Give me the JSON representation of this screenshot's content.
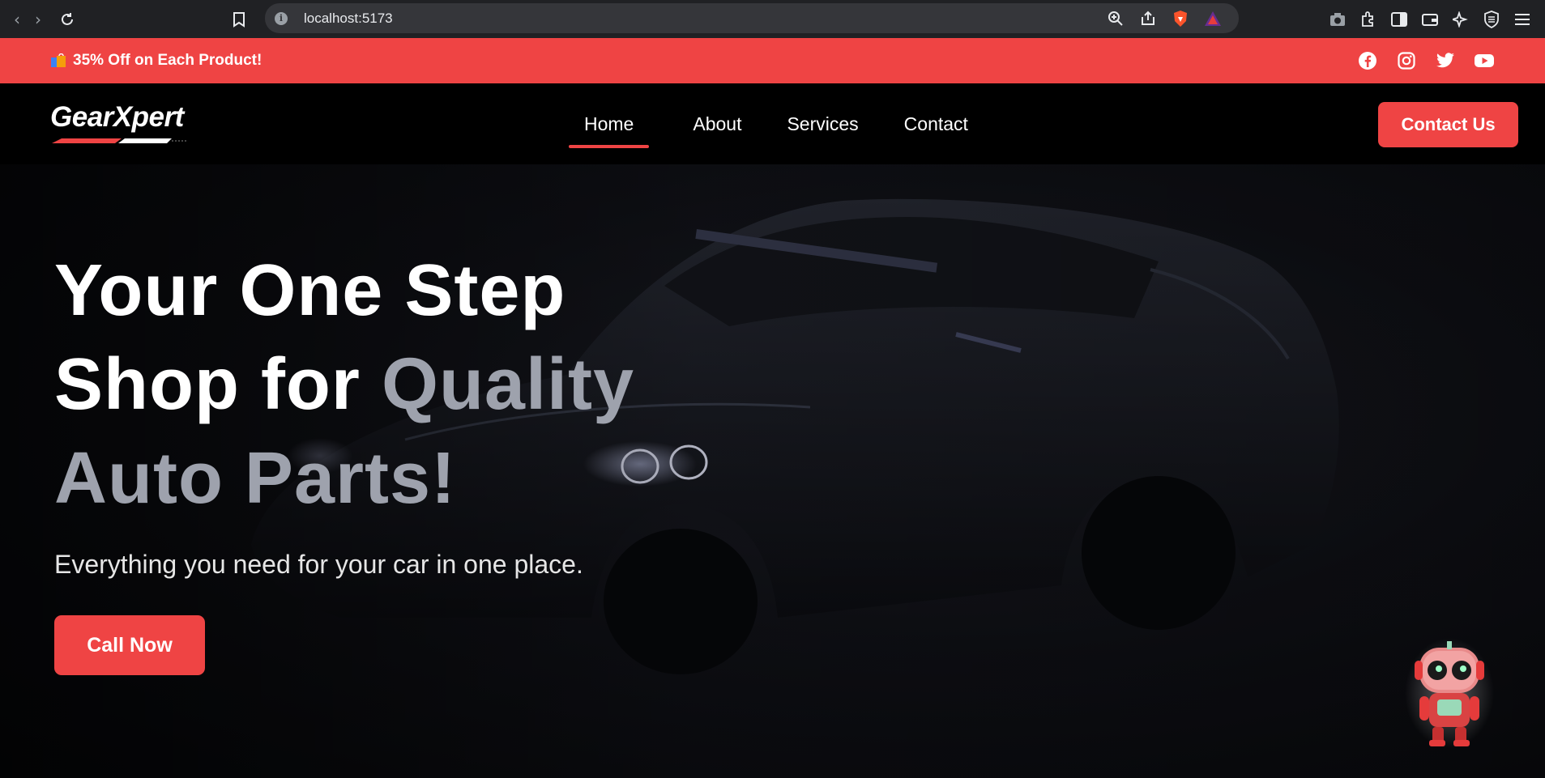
{
  "browser": {
    "url": "localhost:5173"
  },
  "promo": {
    "text": "35% Off on Each Product!",
    "icon": "shopping-bags-icon",
    "socials": [
      "facebook-icon",
      "instagram-icon",
      "twitter-icon",
      "youtube-icon"
    ]
  },
  "nav": {
    "logo": "GearXpert",
    "links": [
      "Home",
      "About",
      "Services",
      "Contact"
    ],
    "active": "Home",
    "cta": "Contact Us"
  },
  "hero": {
    "title_line1": "Your One Step",
    "title_line2_plain": "Shop for ",
    "title_line2_accent": "Quality",
    "title_line3_accent": "Auto Parts!",
    "subtitle": "Everything you need for your car in one place.",
    "cta": "Call Now",
    "chatbot": "robot-avatar"
  },
  "colors": {
    "accent": "#ef4444",
    "muted_text": "#9ea2ad",
    "background": "#000000"
  }
}
